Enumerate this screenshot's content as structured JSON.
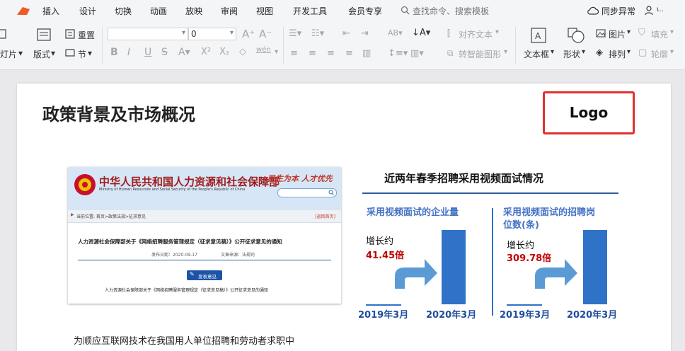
{
  "menu": {
    "tabs": [
      "插入",
      "设计",
      "切换",
      "动画",
      "放映",
      "审阅",
      "视图",
      "开发工具",
      "会员专享"
    ],
    "search": "查找命令、搜索模板",
    "sync": "同步异常",
    "user_short": "ι.."
  },
  "ribbon": {
    "new_slide": "灯片",
    "layout": "版式",
    "reset": "重置",
    "section": "节",
    "font_size": "0",
    "wen": "wén",
    "align_text": "对齐文本",
    "smart_shape": "转智能图形",
    "textbox": "文本框",
    "shape": "形状",
    "picture": "图片",
    "fill": "填充",
    "arrange": "排列",
    "outline": "轮廓"
  },
  "slide": {
    "title": "政策背景及市场概况",
    "logo": "Logo",
    "body_text": "为顺应互联网技术在我国用人单位招聘和劳动者求职中",
    "screenshot": {
      "site_title": "中华人民共和国人力资源和社会保障部",
      "site_subtitle": "Ministry of Human Resources and Social Security of the People's Republic of China",
      "slogan": "民生为本 人才优先",
      "breadcrumb": "当前位置: 首页>政策法规>征求意见",
      "top_link": "[返回首页]",
      "article_title": "人力资源社会保障部关于《网络招聘服务管理规定（征求意见稿）》公开征求意见的通知",
      "publish_date": "发布日期：2020-09-17",
      "source": "文章来源：法规司",
      "feedback_button": "发表意见",
      "footer_text": "人力资源社会保障部关于《网络招聘服务管理规定（征求意见稿）》公开征求意见的通知"
    },
    "infographic": {
      "title": "近两年春季招聘采用视频面试情况",
      "left": {
        "heading": "采用视频面试的企业量",
        "growth_label": "增长约",
        "growth_value": "41.45倍",
        "year1": "2019年3月",
        "year2": "2020年3月"
      },
      "right": {
        "heading_line1": "采用视频面试的招聘岗",
        "heading_line2": "位数(条)",
        "growth_label": "增长约",
        "growth_value": "309.78倍",
        "year1": "2019年3月",
        "year2": "2020年3月"
      }
    }
  },
  "colors": {
    "accent_blue": "#2f72c8",
    "bar_blue": "#2f72c8",
    "arrow_blue": "#5b9bd5",
    "red": "#c00000",
    "logo_border": "#e03030",
    "heading_blue": "#4472c4"
  }
}
